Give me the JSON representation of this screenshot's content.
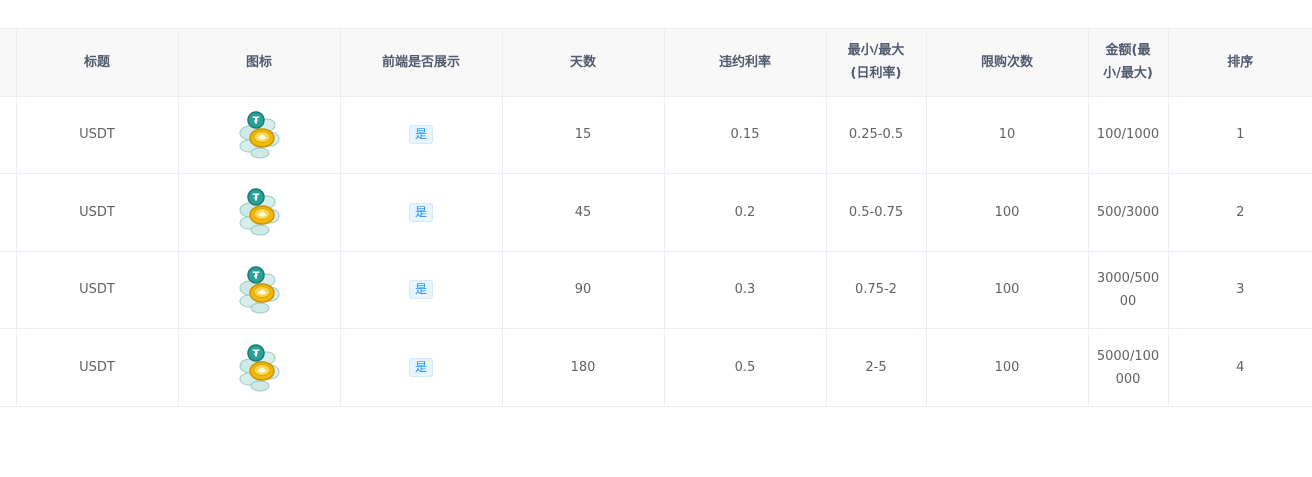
{
  "table": {
    "columns": [
      "",
      "标题",
      "图标",
      "前端是否展示",
      "天数",
      "违约利率",
      "最小/最大(日利率)",
      "限购次数",
      "金额(最小/最大)",
      "排序"
    ],
    "header_labels": {
      "title": "标题",
      "icon": "图标",
      "display": "前端是否展示",
      "days": "天数",
      "penalty_rate": "违约利率",
      "daily_rate_line1": "最小/最大",
      "daily_rate_line2": "(日利率)",
      "limit": "限购次数",
      "amount_line1": "金额(最",
      "amount_line2": "小/最大)",
      "sort": "排序"
    },
    "rows": [
      {
        "title": "USDT",
        "icon": "usdt-coin-icon",
        "display": "是",
        "days": "15",
        "penalty_rate": "0.15",
        "daily_rate": "0.25-0.5",
        "limit": "10",
        "amount": "100/1000",
        "sort": "1"
      },
      {
        "title": "USDT",
        "icon": "usdt-coin-icon",
        "display": "是",
        "days": "45",
        "penalty_rate": "0.2",
        "daily_rate": "0.5-0.75",
        "limit": "100",
        "amount": "500/3000",
        "sort": "2"
      },
      {
        "title": "USDT",
        "icon": "usdt-coin-icon",
        "display": "是",
        "days": "90",
        "penalty_rate": "0.3",
        "daily_rate": "0.75-2",
        "limit": "100",
        "amount": "3000/50000",
        "sort": "3"
      },
      {
        "title": "USDT",
        "icon": "usdt-coin-icon",
        "display": "是",
        "days": "180",
        "penalty_rate": "0.5",
        "daily_rate": "2-5",
        "limit": "100",
        "amount": "5000/100000",
        "sort": "4"
      }
    ]
  },
  "colors": {
    "header_bg": "#f8f8f9",
    "border": "#ebeef5",
    "tag_blue": "#1890ff",
    "coin_teal": "#2aa198",
    "coin_gold": "#f0b90b"
  }
}
